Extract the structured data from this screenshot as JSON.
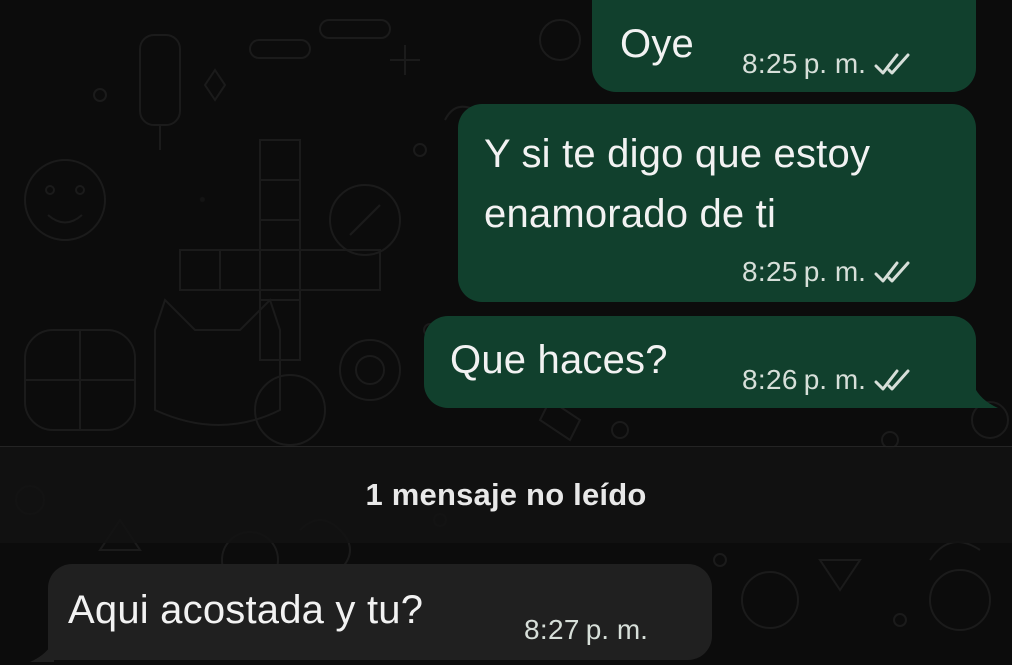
{
  "messages": [
    {
      "text": "Oye",
      "time": "8:25",
      "ampm": "p. m.",
      "status": "read-double-check-icon"
    },
    {
      "text_line1": "Y si te digo que estoy",
      "text_line2": "enamorado de ti",
      "time": "8:25",
      "ampm": "p. m.",
      "status": "read-double-check-icon"
    },
    {
      "text": "Que haces?",
      "time": "8:26",
      "ampm": "p. m.",
      "status": "read-double-check-icon"
    },
    {
      "text": "Aqui acostada y tu?",
      "time": "8:27",
      "ampm": "p. m."
    }
  ],
  "unread_divider": "1 mensaje no leído",
  "colors": {
    "outgoing_bubble": "#11402d",
    "incoming_bubble": "#202020",
    "background": "#0c0c0c",
    "text": "#f2f2f2"
  }
}
